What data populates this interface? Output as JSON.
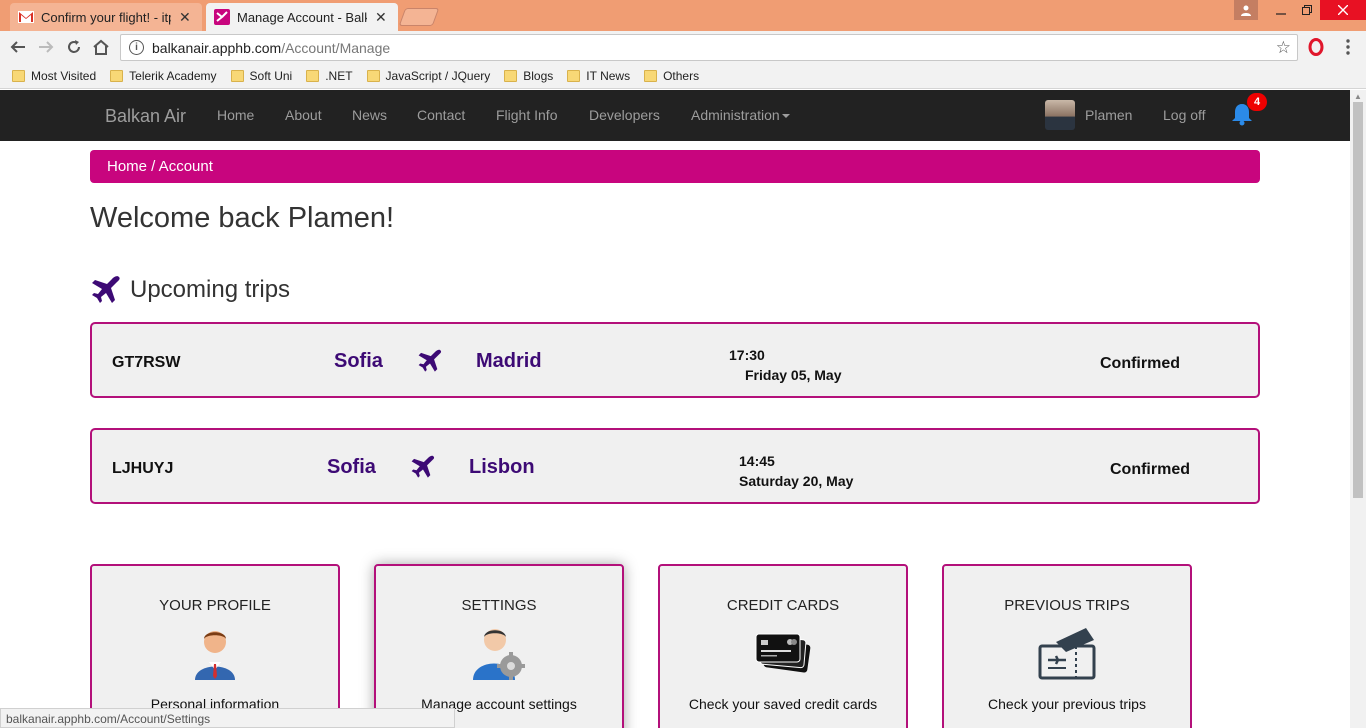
{
  "browser": {
    "tabs": [
      {
        "title": "Confirm your flight! - itpl",
        "active": false
      },
      {
        "title": "Manage Account - Balkan",
        "active": true
      }
    ],
    "close_glyph": "✕",
    "url_host": "balkanair.apphb.com",
    "url_path": "/Account/Manage",
    "bookmarks": [
      "Most Visited",
      "Telerik Academy",
      "Soft Uni",
      ".NET",
      "JavaScript / JQuery",
      "Blogs",
      "IT News",
      "Others"
    ],
    "status_text": "balkanair.apphb.com/Account/Settings"
  },
  "navbar": {
    "brand": "Balkan Air",
    "links": [
      "Home",
      "About",
      "News",
      "Contact",
      "Flight Info",
      "Developers",
      "Administration"
    ],
    "user": "Plamen",
    "logoff": "Log off",
    "notifications": "4"
  },
  "breadcrumb": "Home / Account",
  "welcome": "Welcome back Plamen!",
  "upcoming_title": "Upcoming trips",
  "trips": [
    {
      "code": "GT7RSW",
      "from": "Sofia",
      "to": "Madrid",
      "time": "17:30",
      "date": "Friday 05, May",
      "status": "Confirmed"
    },
    {
      "code": "LJHUYJ",
      "from": "Sofia",
      "to": "Lisbon",
      "time": "14:45",
      "date": "Saturday 20, May",
      "status": "Confirmed"
    }
  ],
  "cards": [
    {
      "title": "YOUR PROFILE",
      "desc": "Personal information",
      "icon": "user-profile-icon"
    },
    {
      "title": "SETTINGS",
      "desc": "Manage account settings",
      "icon": "user-settings-icon"
    },
    {
      "title": "CREDIT CARDS",
      "desc": "Check your saved credit cards",
      "icon": "credit-cards-icon"
    },
    {
      "title": "PREVIOUS TRIPS",
      "desc": "Check your previous trips",
      "icon": "ticket-icon"
    }
  ],
  "colors": {
    "accent": "#c8057e",
    "border": "#b3107a",
    "city": "#3d0a75",
    "navbar": "#222222"
  }
}
